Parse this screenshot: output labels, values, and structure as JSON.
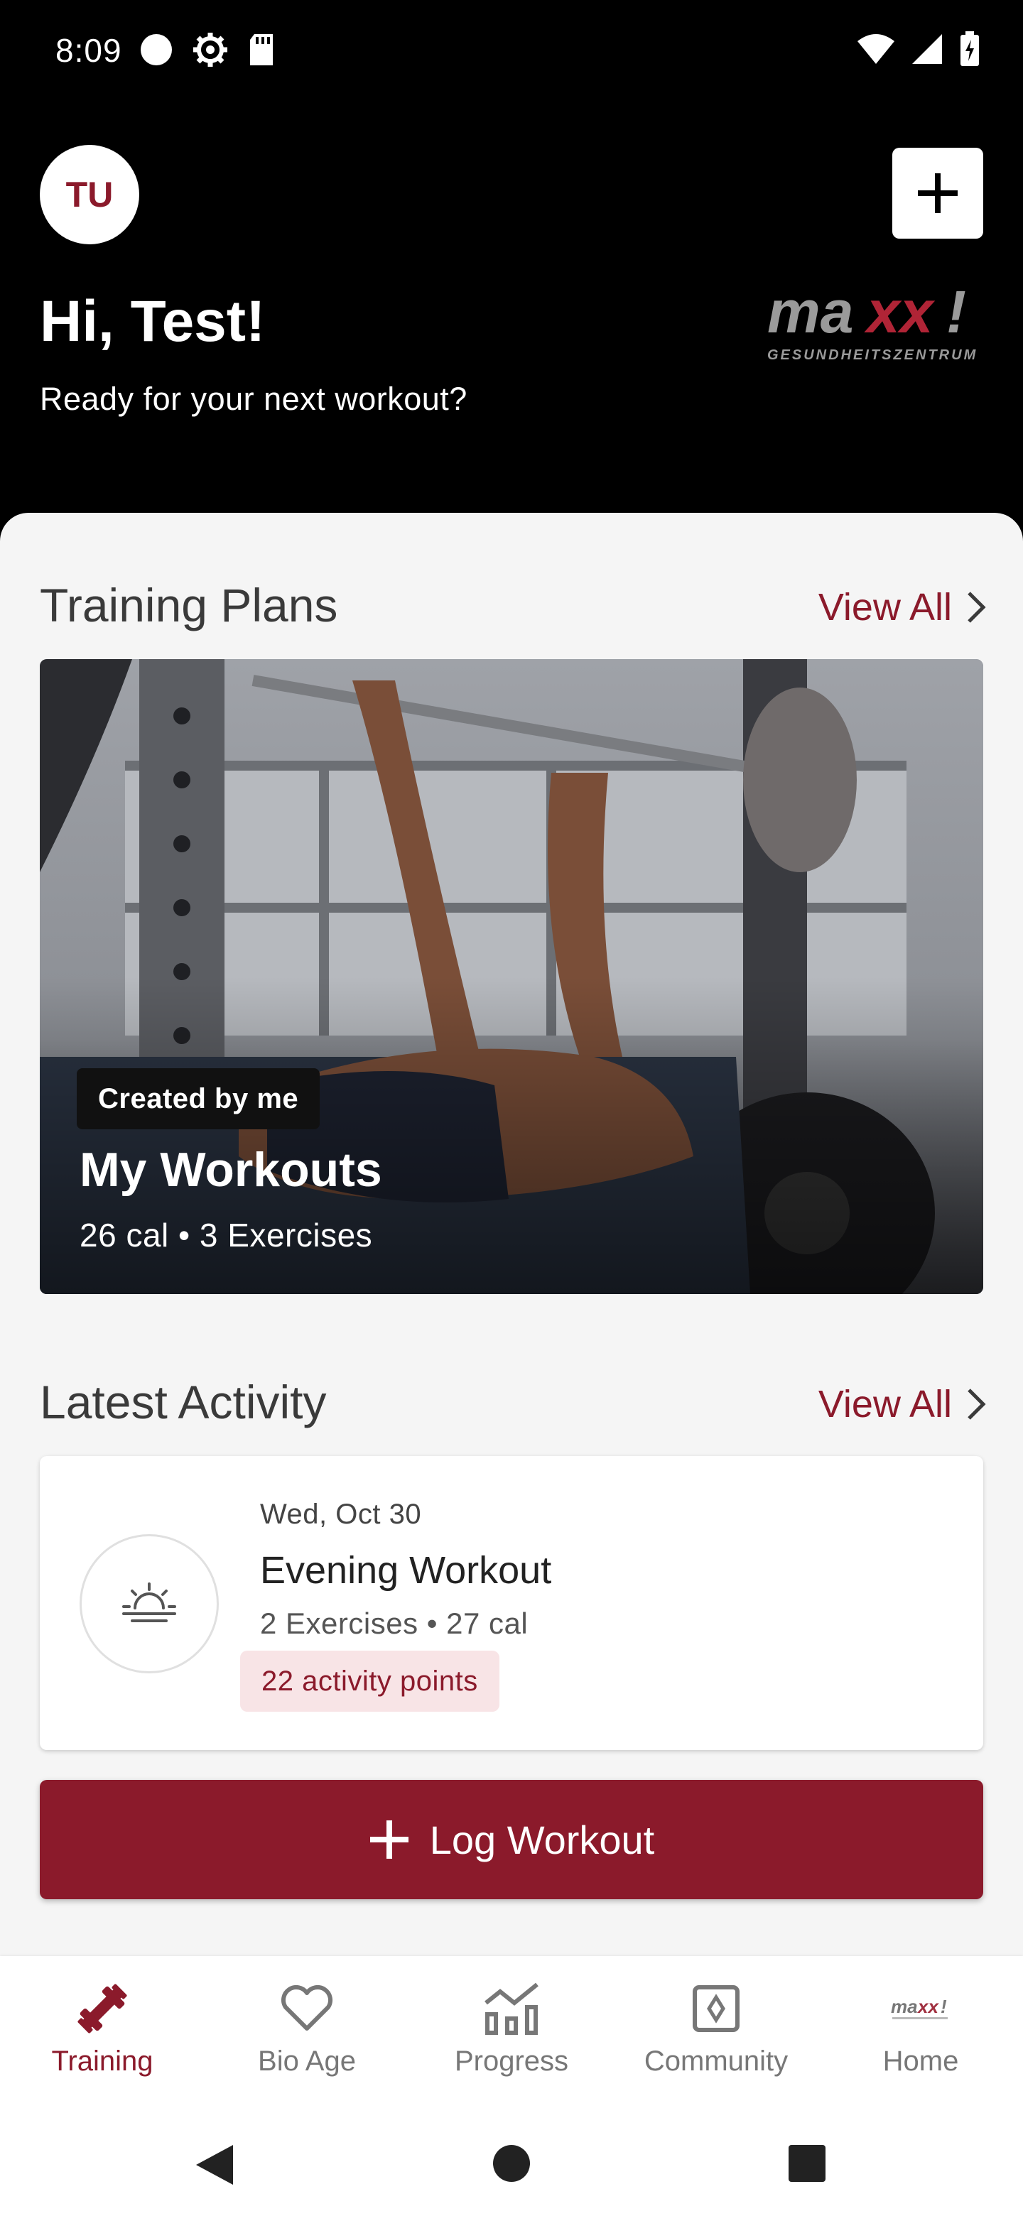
{
  "status_bar": {
    "time": "8:09"
  },
  "header": {
    "avatar_initials": "TU",
    "greeting": "Hi, Test!",
    "subtitle": "Ready for your next workout?",
    "logo_text": "maxx!",
    "logo_subtext": "GESUNDHEITSZENTRUM"
  },
  "training_plans": {
    "section_title": "Training Plans",
    "view_all_label": "View All",
    "card": {
      "badge": "Created by me",
      "title": "My Workouts",
      "meta": "26 cal • 3 Exercises"
    }
  },
  "latest_activity": {
    "section_title": "Latest Activity",
    "view_all_label": "View All",
    "card": {
      "date": "Wed, Oct 30",
      "title": "Evening Workout",
      "meta": "2 Exercises • 27 cal",
      "points": "22 activity points",
      "icon": "sunset-icon"
    }
  },
  "log_button_label": "Log Workout",
  "bottom_nav": {
    "items": [
      {
        "label": "Training",
        "icon": "dumbbell-icon",
        "active": true
      },
      {
        "label": "Bio Age",
        "icon": "heart-icon",
        "active": false
      },
      {
        "label": "Progress",
        "icon": "chart-icon",
        "active": false
      },
      {
        "label": "Community",
        "icon": "community-icon",
        "active": false
      },
      {
        "label": "Home",
        "icon": "maxx-logo-icon",
        "active": false
      }
    ]
  },
  "colors": {
    "accent": "#8b1a2b",
    "header_bg": "#000000",
    "sheet_bg": "#f5f5f5",
    "points_bg": "#f8e4e6"
  }
}
